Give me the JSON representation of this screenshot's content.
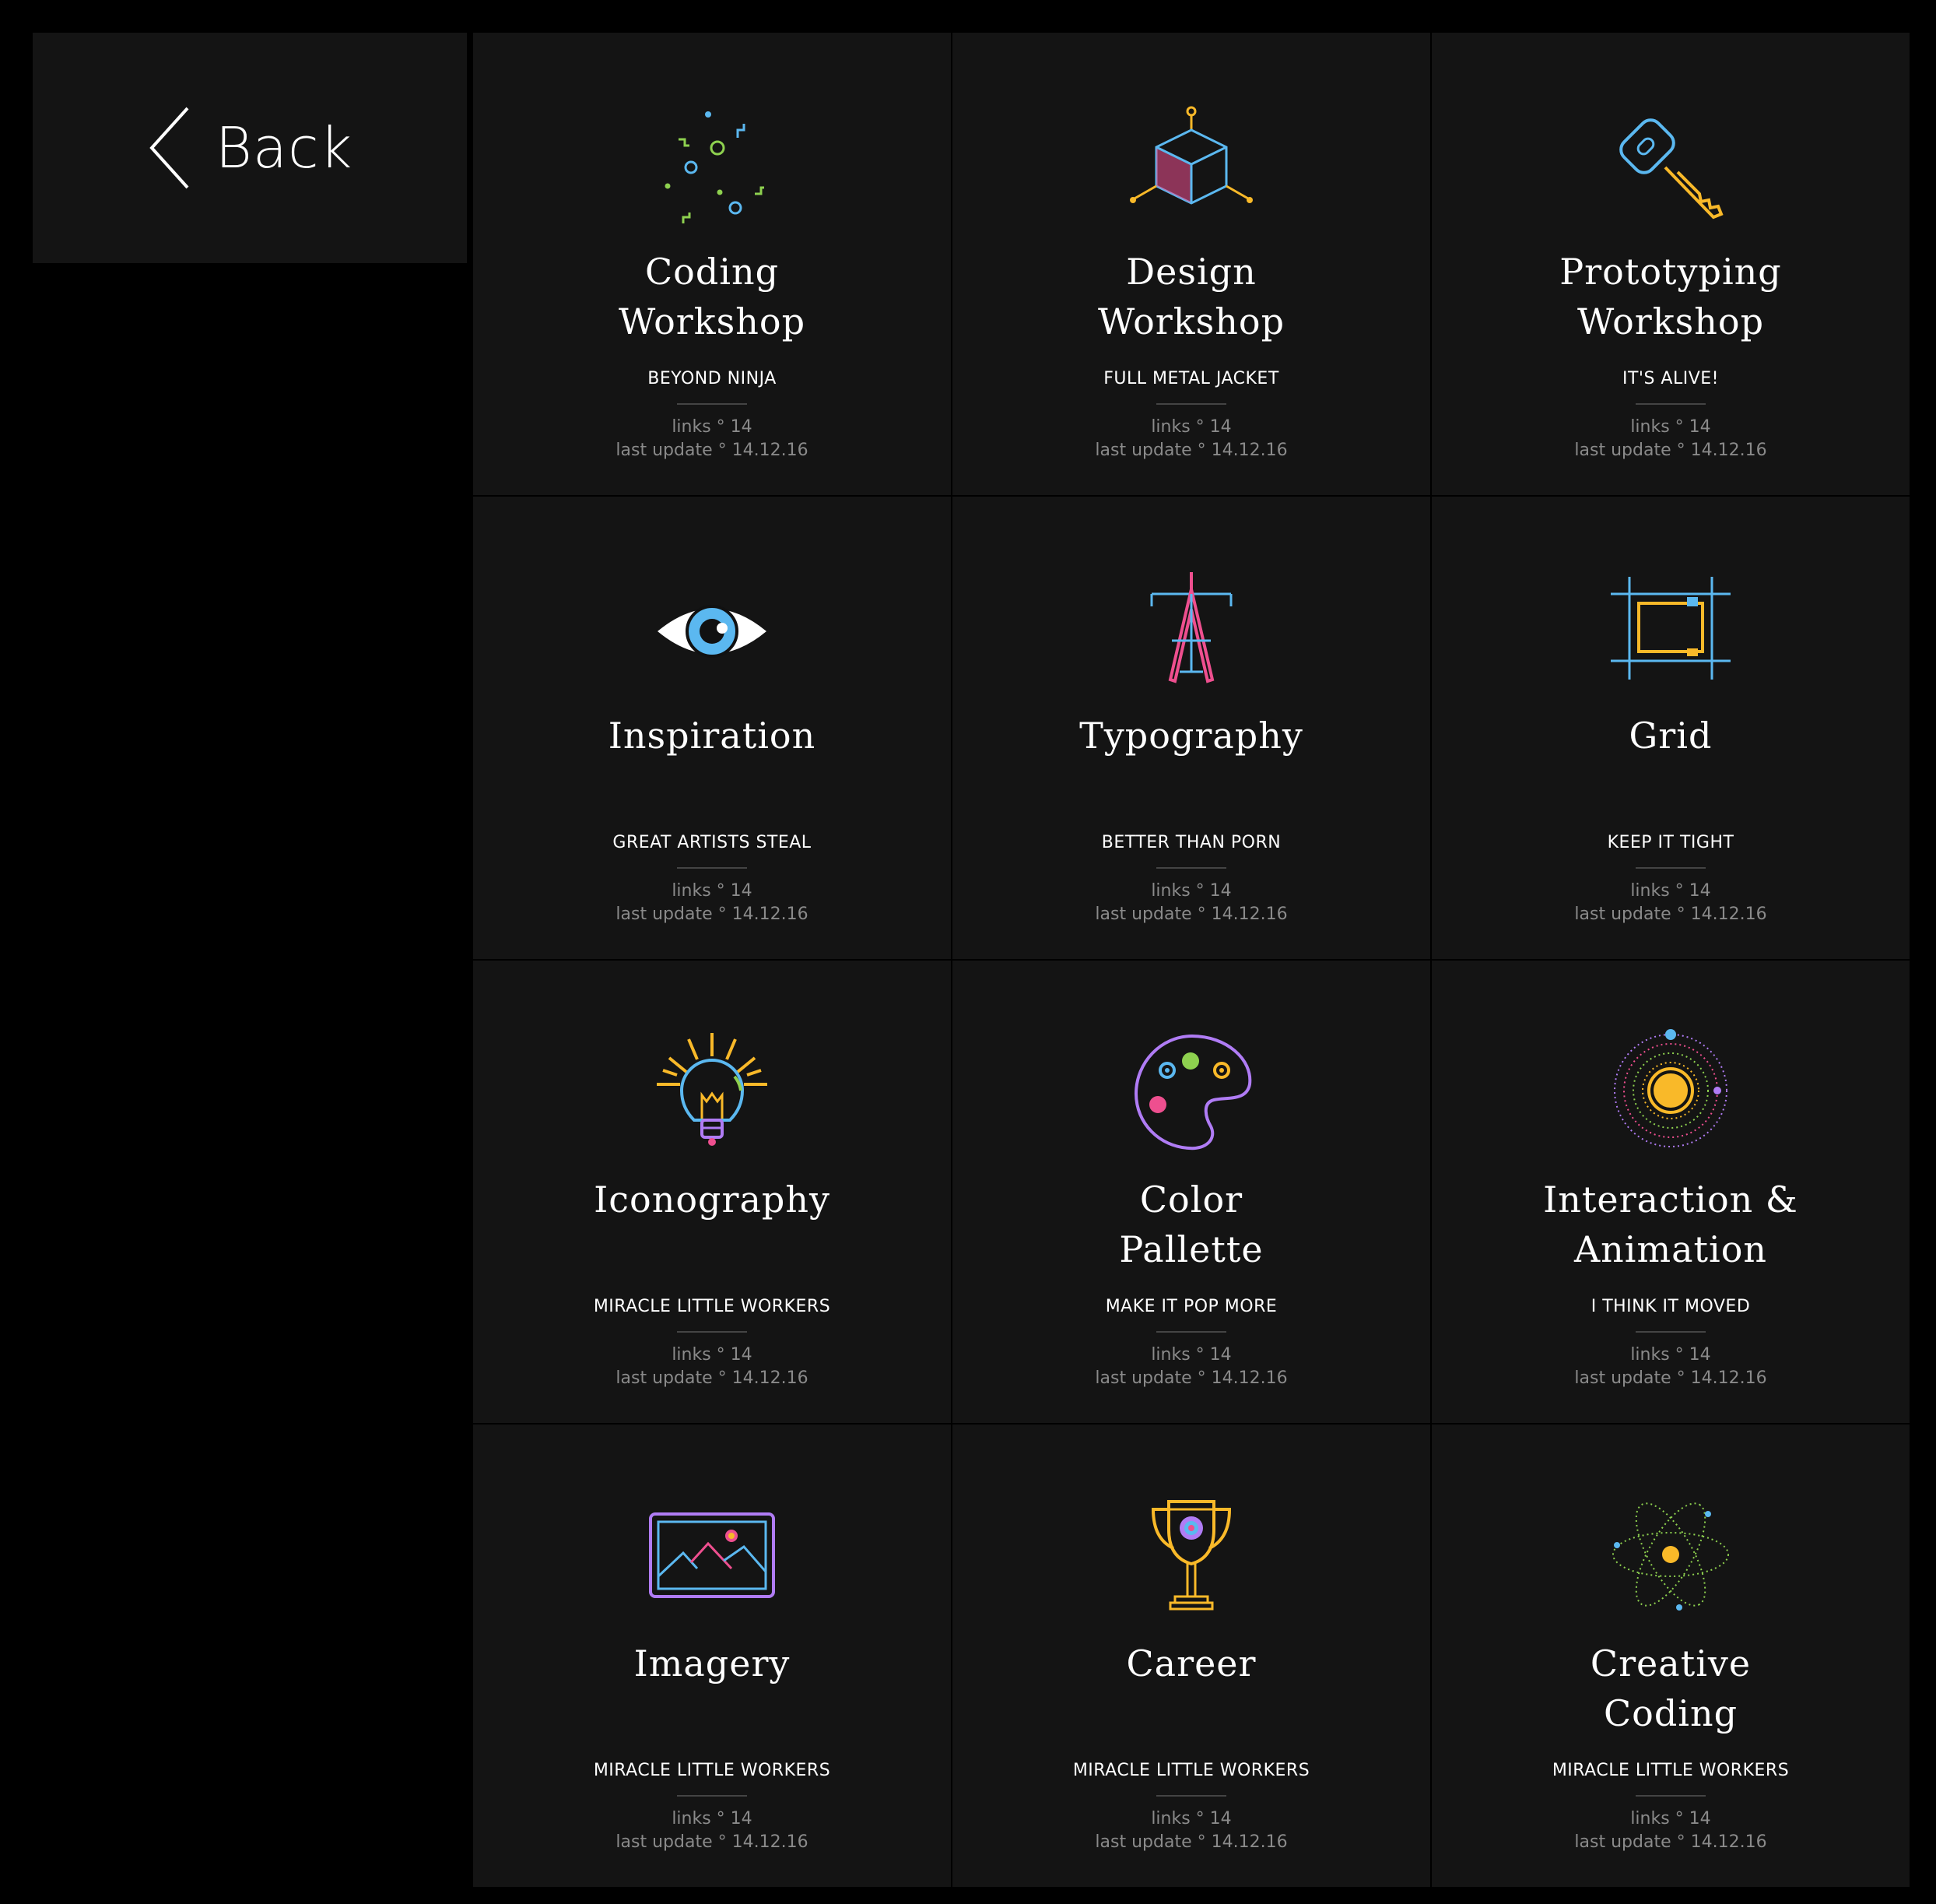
{
  "back": {
    "label": "Back"
  },
  "cards": [
    {
      "title1": "Coding",
      "title2": "Workshop",
      "subtitle": "BEYOND NINJA",
      "links": "links ° 14",
      "updated": "last update ° 14.12.16",
      "icon": "confetti-icon"
    },
    {
      "title1": "Design",
      "title2": "Workshop",
      "subtitle": "FULL METAL JACKET",
      "links": "links ° 14",
      "updated": "last update ° 14.12.16",
      "icon": "cube-icon"
    },
    {
      "title1": "Prototyping",
      "title2": "Workshop",
      "subtitle": "IT'S ALIVE!",
      "links": "links ° 14",
      "updated": "last update ° 14.12.16",
      "icon": "key-icon"
    },
    {
      "title1": "Inspiration",
      "title2": "",
      "subtitle": "GREAT ARTISTS STEAL",
      "links": "links ° 14",
      "updated": "last update ° 14.12.16",
      "icon": "eye-icon"
    },
    {
      "title1": "Typography",
      "title2": "",
      "subtitle": "BETTER THAN PORN",
      "links": "links ° 14",
      "updated": "last update ° 14.12.16",
      "icon": "compass-icon"
    },
    {
      "title1": "Grid",
      "title2": "",
      "subtitle": "KEEP IT TIGHT",
      "links": "links ° 14",
      "updated": "last update ° 14.12.16",
      "icon": "grid-icon"
    },
    {
      "title1": "Iconography",
      "title2": "",
      "subtitle": "MIRACLE LITTLE WORKERS",
      "links": "links ° 14",
      "updated": "last update ° 14.12.16",
      "icon": "lightbulb-icon"
    },
    {
      "title1": "Color",
      "title2": "Pallette",
      "subtitle": "MAKE IT POP MORE",
      "links": "links ° 14",
      "updated": "last update ° 14.12.16",
      "icon": "palette-icon"
    },
    {
      "title1": "Interaction &",
      "title2": "Animation",
      "subtitle": "I THINK IT MOVED",
      "links": "links ° 14",
      "updated": "last update ° 14.12.16",
      "icon": "orbit-icon"
    },
    {
      "title1": "Imagery",
      "title2": "",
      "subtitle": "MIRACLE LITTLE WORKERS",
      "links": "links ° 14",
      "updated": "last update ° 14.12.16",
      "icon": "image-icon"
    },
    {
      "title1": "Career",
      "title2": "",
      "subtitle": "MIRACLE LITTLE WORKERS",
      "links": "links ° 14",
      "updated": "last update ° 14.12.16",
      "icon": "trophy-icon"
    },
    {
      "title1": "Creative",
      "title2": "Coding",
      "subtitle": "MIRACLE LITTLE WORKERS",
      "links": "links ° 14",
      "updated": "last update ° 14.12.16",
      "icon": "atom-icon"
    }
  ],
  "colors": {
    "background": "#000000",
    "card": "#141414",
    "blue": "#5bb8f0",
    "green": "#8ed14f",
    "yellow": "#f9b929",
    "pink": "#ee4f8f",
    "purple": "#b07cf5",
    "orange": "#f5a623"
  }
}
